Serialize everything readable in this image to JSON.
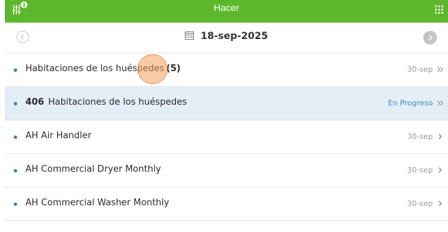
{
  "header": {
    "title": "Hacer",
    "filter_badge": "1"
  },
  "date_nav": {
    "date": "18-sep-2025"
  },
  "rows": [
    {
      "prefix": "",
      "label": "Habitaciones de los huéspedes",
      "count": "(5)",
      "meta": "30-sep",
      "chevron": "double-chevron-right-icon"
    },
    {
      "prefix": "406",
      "label": "Habitaciones de los huéspedes",
      "count": "",
      "meta": "En Progreso",
      "chevron": "double-chevron-right-icon"
    },
    {
      "prefix": "",
      "label": "AH Air Handler",
      "count": "",
      "meta": "30-sep",
      "chevron": "chevron-right-icon"
    },
    {
      "prefix": "",
      "label": "AH Commercial Dryer Monthly",
      "count": "",
      "meta": "30-sep",
      "chevron": "chevron-right-icon"
    },
    {
      "prefix": "",
      "label": "AH Commercial Washer Monthly",
      "count": "",
      "meta": "30-sep",
      "chevron": "chevron-right-icon"
    }
  ],
  "colors": {
    "header_bg": "#5cb82b",
    "active_row_bg": "#e3eef6",
    "status_in_progress": "#3a8fc7",
    "bullet": "#2d8f8a"
  }
}
